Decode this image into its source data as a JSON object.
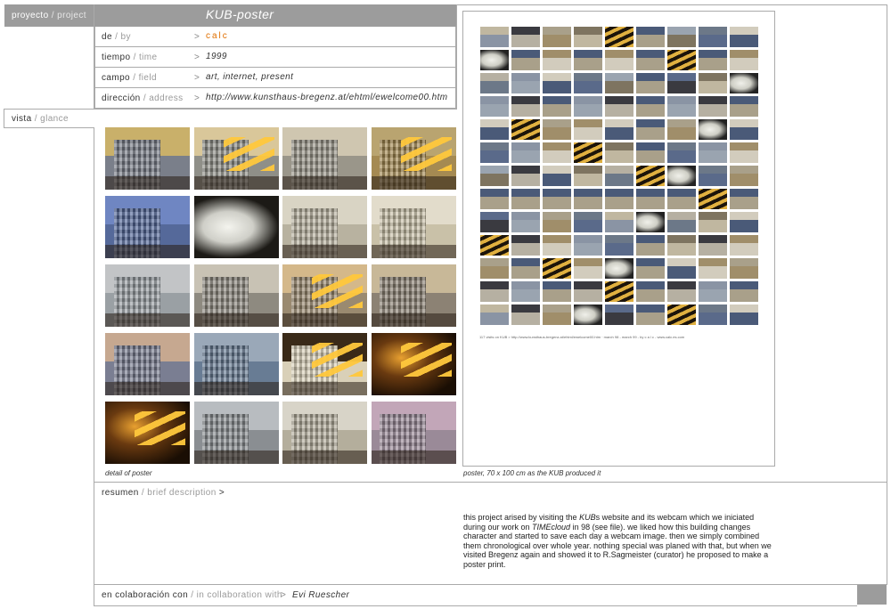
{
  "header": {
    "project_es": "proyecto",
    "sep": "/",
    "project_en": "project",
    "title": "KUB-poster"
  },
  "info": [
    {
      "label_es": "de",
      "label_en": "by",
      "arrow": ">",
      "value": "calc"
    },
    {
      "label_es": "tiempo",
      "label_en": "time",
      "arrow": ">",
      "value": "1999"
    },
    {
      "label_es": "campo",
      "label_en": "field",
      "arrow": ">",
      "value": "art, internet, present"
    },
    {
      "label_es": "dirección",
      "label_en": "address",
      "arrow": ">",
      "value": "http://www.kunsthaus-bregenz.at/ehtml/ewelcome00.htm"
    }
  ],
  "vista": {
    "label_es": "vista",
    "label_en": "glance"
  },
  "detail_caption": "detail of poster",
  "poster_caption": "poster, 70 x 100 cm as the KUB produced it",
  "poster_footer": "117 visits on KUB > http://www.kunsthaus-bregenz.at/ehtml/ewelcome00.htm · march 98 - march 99 - by c a l c - www.calc.es.com",
  "resumen": {
    "label_es": "resumen",
    "label_en": "brief description",
    "arrow": ">"
  },
  "description": [
    "this project arised by visiting the ",
    "KUB",
    "s website and its webcam which we iniciated during our work on ",
    "TIMEcloud",
    " in 98 (see file). we liked how this building changes character and started to save each day a webcam image. then we simply combined them chronological over whole year. nothing special was planed with that, but when we visited Bregenz again and showed it to R.Sagmeister (curator) he proposed to make a poster print."
  ],
  "collab": {
    "label_es": "en colaboración con",
    "label_en": "in collaboration with",
    "arrow": ">",
    "value": "Evi Ruescher"
  },
  "colors": {
    "bar_gray": "#9c9c9c",
    "border": "#aaaaaa",
    "accent_orange": "#e07000"
  },
  "thumbnails": [
    {
      "sky": "#c9b06a",
      "bld": "#7a7f8a",
      "mode": "day"
    },
    {
      "sky": "#d9c79a",
      "bld": "#8f8f88",
      "mode": "stripes"
    },
    {
      "sky": "#cfc6b0",
      "bld": "#9a968a",
      "mode": "day"
    },
    {
      "sky": "#b9a470",
      "bld": "#a58a52",
      "mode": "stripes"
    },
    {
      "sky": "#6f86c2",
      "bld": "#55699a",
      "mode": "blue"
    },
    {
      "sky": "#222222",
      "bld": "#e8e8e0",
      "mode": "white"
    },
    {
      "sky": "#d9d4c4",
      "bld": "#b8b2a0",
      "mode": "day"
    },
    {
      "sky": "#e2dccb",
      "bld": "#c9c1a8",
      "mode": "day"
    },
    {
      "sky": "#c2c4c6",
      "bld": "#9aa0a4",
      "mode": "day"
    },
    {
      "sky": "#c8c2b4",
      "bld": "#8e8a80",
      "mode": "day"
    },
    {
      "sky": "#d4b88a",
      "bld": "#9a8a70",
      "mode": "stripes"
    },
    {
      "sky": "#c8b898",
      "bld": "#8c8274",
      "mode": "day"
    },
    {
      "sky": "#c6a890",
      "bld": "#7a7e92",
      "mode": "day"
    },
    {
      "sky": "#9aa8b8",
      "bld": "#687c94",
      "mode": "blue"
    },
    {
      "sky": "#3a2a18",
      "bld": "#d9d0b8",
      "mode": "stripes"
    },
    {
      "sky": "#1a1208",
      "bld": "#2a1c0c",
      "mode": "night"
    },
    {
      "sky": "#2a1606",
      "bld": "#3a2208",
      "mode": "night"
    },
    {
      "sky": "#b8bcc0",
      "bld": "#8a8e92",
      "mode": "day"
    },
    {
      "sky": "#d8d4c8",
      "bld": "#b4ae9c",
      "mode": "day"
    },
    {
      "sky": "#c2a6b8",
      "bld": "#9a8a98",
      "mode": "day"
    }
  ]
}
